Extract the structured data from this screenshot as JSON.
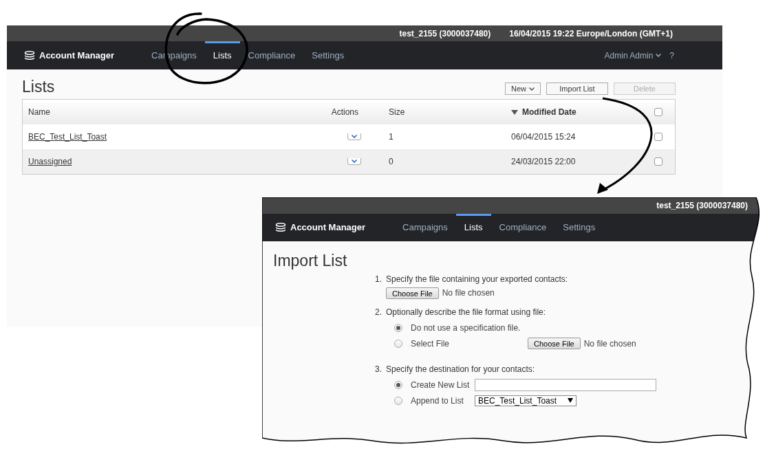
{
  "lists_screen": {
    "top_bar": {
      "account": "test_2155 (3000037480)",
      "datetime": "16/04/2015 19:22 Europe/London (GMT+1)"
    },
    "nav": {
      "app_name": "Account Manager",
      "tabs": [
        {
          "label": "Campaigns",
          "selected": false
        },
        {
          "label": "Lists",
          "selected": true
        },
        {
          "label": "Compliance",
          "selected": false
        },
        {
          "label": "Settings",
          "selected": false
        }
      ],
      "user_menu": "Admin Admin",
      "help": "?"
    },
    "title": "Lists",
    "toolbar": [
      {
        "label": "New",
        "kind": "dropdown",
        "disabled": false
      },
      {
        "label": "Import List",
        "kind": "button",
        "disabled": false
      },
      {
        "label": "Delete",
        "kind": "button",
        "disabled": true
      }
    ],
    "table": {
      "columns": [
        {
          "label": "Name"
        },
        {
          "label": "Actions"
        },
        {
          "label": "Size"
        },
        {
          "label": "Modified Date",
          "sorted": true
        }
      ],
      "header_checked": false,
      "rows": [
        {
          "name": "BEC_Test_List_Toast",
          "size": "1",
          "modified": "06/04/2015 15:24",
          "checked": false
        },
        {
          "name": "Unassigned",
          "size": "0",
          "modified": "24/03/2015 22:00",
          "checked": false
        }
      ]
    }
  },
  "import_screen": {
    "top_bar": {
      "account": "test_2155 (3000037480)"
    },
    "nav": {
      "app_name": "Account Manager",
      "tabs": [
        {
          "label": "Campaigns",
          "selected": false
        },
        {
          "label": "Lists",
          "selected": true
        },
        {
          "label": "Compliance",
          "selected": false
        },
        {
          "label": "Settings",
          "selected": false
        }
      ]
    },
    "title": "Import List",
    "steps": [
      {
        "number": "1.",
        "text": "Specify the file containing your exported contacts:",
        "file_input": {
          "button": "Choose File",
          "status": "No file chosen"
        }
      },
      {
        "number": "2.",
        "text": "Optionally describe the file format using file:",
        "options": [
          {
            "label": "Do not use a specification file.",
            "selected": true,
            "kind": "plain"
          },
          {
            "label": "Select File",
            "selected": false,
            "kind": "file",
            "file_input": {
              "button": "Choose File",
              "status": "No file chosen"
            }
          }
        ]
      },
      {
        "number": "3.",
        "text": "Specify the destination for your contacts:",
        "options": [
          {
            "label": "Create New List",
            "selected": true,
            "kind": "text"
          },
          {
            "label": "Append to List",
            "selected": false,
            "kind": "select",
            "value": "BEC_Test_List_Toast"
          }
        ]
      }
    ]
  }
}
